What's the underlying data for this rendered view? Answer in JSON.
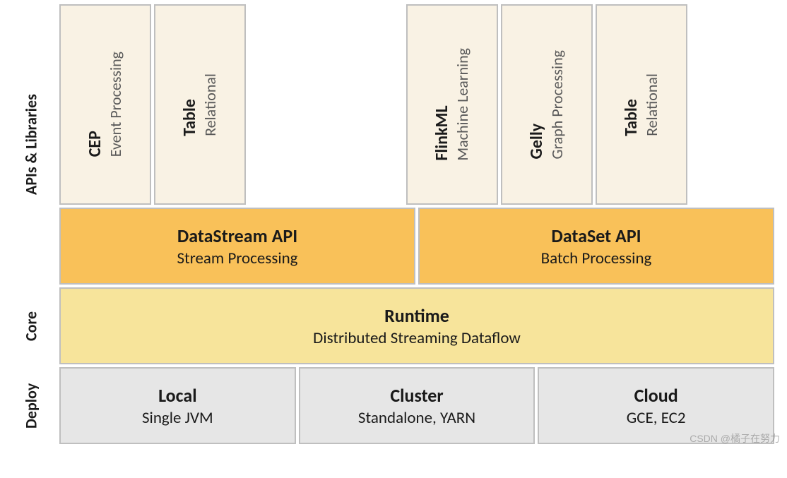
{
  "rows": {
    "apis_label": "APIs & Libraries",
    "core_label": "Core",
    "deploy_label": "Deploy"
  },
  "libraries": {
    "left": [
      {
        "name": "CEP",
        "subtitle": "Event Processing"
      },
      {
        "name": "Table",
        "subtitle": "Relational"
      }
    ],
    "right": [
      {
        "name": "FlinkML",
        "subtitle": "Machine Learning"
      },
      {
        "name": "Gelly",
        "subtitle": "Graph Processing"
      },
      {
        "name": "Table",
        "subtitle": "Relational"
      }
    ]
  },
  "apis": [
    {
      "name": "DataStream API",
      "subtitle": "Stream Processing"
    },
    {
      "name": "DataSet API",
      "subtitle": "Batch Processing"
    }
  ],
  "core": {
    "name": "Runtime",
    "subtitle": "Distributed Streaming Dataflow"
  },
  "deploy": [
    {
      "name": "Local",
      "subtitle": "Single JVM"
    },
    {
      "name": "Cluster",
      "subtitle": "Standalone, YARN"
    },
    {
      "name": "Cloud",
      "subtitle": "GCE, EC2"
    }
  ],
  "watermark": "CSDN @橘子在努力",
  "colors": {
    "lib_bg": "#f9f2e4",
    "api_bg": "#f9c159",
    "core_bg": "#f7e49b",
    "deploy_bg": "#e6e6e6",
    "border": "#bfbfbf"
  }
}
